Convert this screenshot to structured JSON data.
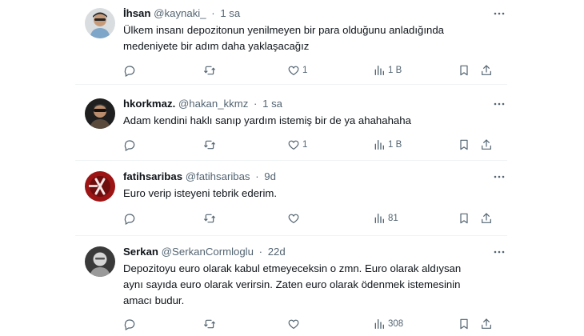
{
  "tweets": [
    {
      "name": "İhsan",
      "handle": "@kaynaki_",
      "separator": "·",
      "time": "1 sa",
      "lines": [
        "Ülkem insanı depozitonun yenilmeyen bir para olduğunu anladığında",
        "medeniyete bir adım daha yaklaşacağız"
      ],
      "likes": "1",
      "views": "1 B"
    },
    {
      "name": "hkorkmaz.",
      "handle": "@hakan_kkmz",
      "separator": "·",
      "time": "1 sa",
      "lines": [
        "Adam kendini haklı sanıp yardım istemiş bir de ya ahahahaha"
      ],
      "likes": "1",
      "views": "1 B"
    },
    {
      "name": "fatihsaribas",
      "handle": "@fatihsaribas",
      "separator": "·",
      "time": "9d",
      "lines": [
        "Euro verip isteyeni tebrik ederim."
      ],
      "likes": "",
      "views": "81"
    },
    {
      "name": "Serkan",
      "handle": "@SerkanCormloglu",
      "separator": "·",
      "time": "22d",
      "lines": [
        "Depozitoyu euro olarak kabul etmeyeceksin o zmn. Euro olarak aldıysan",
        "aynı sayıda euro olarak verirsin. Zaten euro olarak ödenmek istemesinin",
        "amacı budur."
      ],
      "likes": "",
      "views": "308"
    }
  ],
  "icons": {
    "more": "more-icon",
    "reply": "reply-icon",
    "retweet": "retweet-icon",
    "like": "like-icon",
    "views": "views-icon",
    "bookmark": "bookmark-icon",
    "share": "share-icon"
  },
  "colors": {
    "text": "#0f1419",
    "secondary": "#536471",
    "divider": "#eff3f4"
  }
}
